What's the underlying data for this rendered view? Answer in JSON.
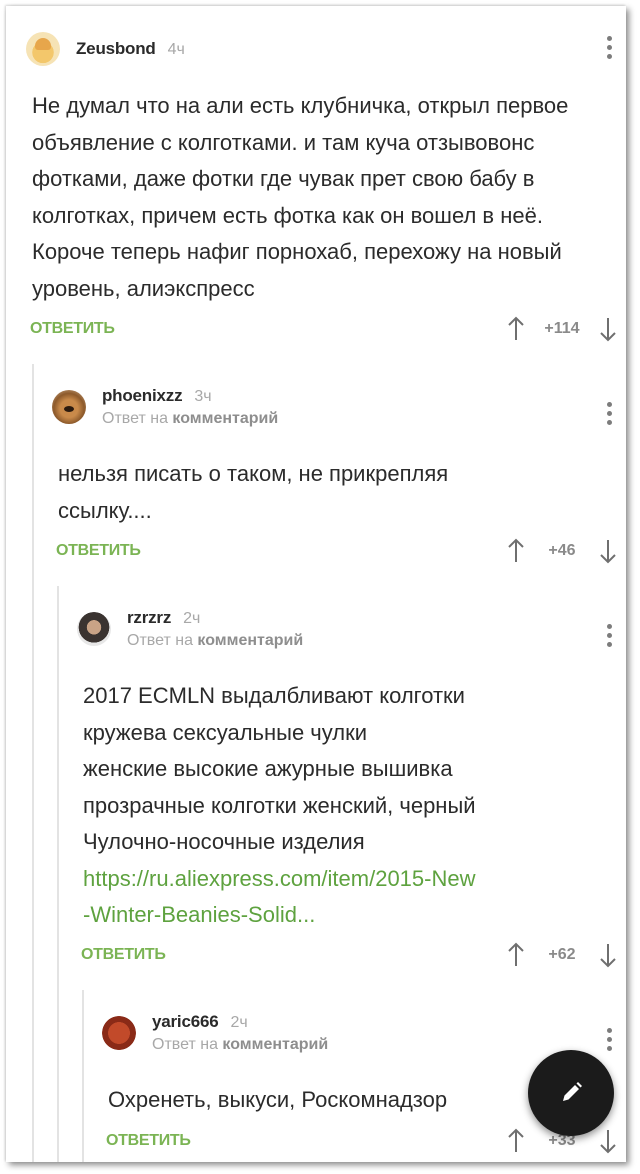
{
  "comments": [
    {
      "username": "Zeusbond",
      "time": "4ч",
      "reply_to": "",
      "text": "Не думал что на али есть клубничка, открыл первое объявление с колготками. и там куча отзывовонс фотками, даже фотки где чувак прет свою бабу в колготках, причем есть фотка как он вошел в неё. Короче теперь нафиг порнохаб, перехожу на новый уровень, алиэкспресс",
      "reply_label": "ОТВЕТИТЬ",
      "score": "+114"
    },
    {
      "username": "phoenixzz",
      "time": "3ч",
      "reply_to": "Ответ на",
      "reply_to_target": "комментарий",
      "text": "нельзя писать о таком, не прикрепляя ссылку....",
      "reply_label": "ОТВЕТИТЬ",
      "score": "+46"
    },
    {
      "username": "rzrzrz",
      "time": "2ч",
      "reply_to": "Ответ на",
      "reply_to_target": "комментарий",
      "lines": [
        "2017 ECMLN выдалбливают колготки",
        "кружева сексуальные чулки",
        "женские высокие ажурные вышивка",
        "прозрачные колготки женский, черный",
        "Чулочно-носочные изделия"
      ],
      "link_1": "https://ru.aliexpress.com/item/2015-New",
      "link_2": "-Winter-Beanies-Solid...",
      "reply_label": "ОТВЕТИТЬ",
      "score": "+62"
    },
    {
      "username": "yaric666",
      "time": "2ч",
      "reply_to": "Ответ на",
      "reply_to_target": "комментарий",
      "text": "Охренеть, выкуси, Роскомнадзор",
      "reply_label": "ОТВЕТИТЬ",
      "score": "+33"
    }
  ],
  "icons": {
    "upvote": "arrow-up-icon",
    "downvote": "arrow-down-icon",
    "menu": "kebab-menu-icon",
    "compose": "pencil-icon"
  },
  "colors": {
    "accent_green": "#7bb454",
    "link_green": "#5ea23f",
    "fab": "#1b1b1b"
  }
}
